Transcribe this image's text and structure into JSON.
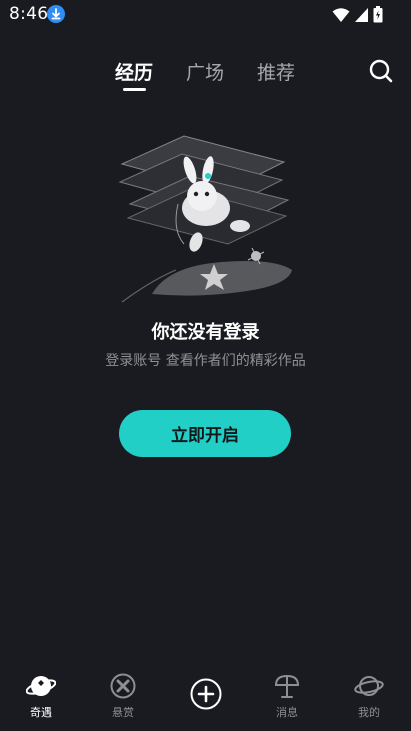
{
  "status_bar": {
    "time": "8:46",
    "icons": [
      "download-badge-icon",
      "wifi-icon",
      "cellular-signal-icon",
      "battery-charging-icon"
    ]
  },
  "header": {
    "tabs": [
      {
        "label": "经历",
        "active": true
      },
      {
        "label": "广场",
        "active": false
      },
      {
        "label": "推荐",
        "active": false
      }
    ],
    "search_icon": "search-icon"
  },
  "empty_state": {
    "illustration": "rabbit-on-phones-illustration",
    "title": "你还没有登录",
    "subtitle": "登录账号 查看作者们的精彩作品",
    "cta_label": "立即开启"
  },
  "bottom_nav": {
    "items": [
      {
        "label": "奇遇",
        "icon": "planet-icon",
        "active": true
      },
      {
        "label": "悬赏",
        "icon": "bounty-icon",
        "active": false
      },
      {
        "label": "",
        "icon": "add-icon",
        "active": false
      },
      {
        "label": "消息",
        "icon": "message-icon",
        "active": false
      },
      {
        "label": "我的",
        "icon": "profile-icon",
        "active": false
      }
    ]
  },
  "colors": {
    "background": "#1a1b20",
    "accent": "#21cfc7",
    "text_primary": "#ffffff",
    "text_secondary": "#8f9096"
  }
}
